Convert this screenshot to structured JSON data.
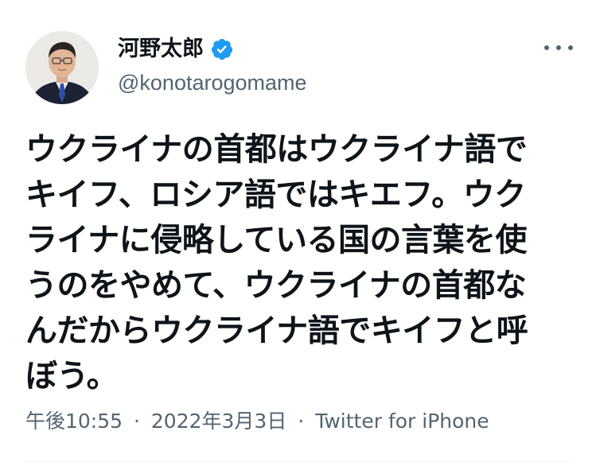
{
  "author": {
    "display_name": "河野太郎",
    "handle": "@konotarogomame",
    "verified_icon": "verified-badge-icon",
    "verified_color": "#1d9bf0"
  },
  "more_icon": "more-horizontal-icon",
  "tweet": {
    "lines": [
      "ウクライナの首都はウクライナ語で",
      "キイフ、ロシア語ではキエフ。ウク",
      "ライナに侵略している国の言葉を使",
      "うのをやめて、ウクライナの首都な",
      "んだからウクライナ語でキイフと呼",
      "ぼう。"
    ]
  },
  "meta": {
    "time": "午後10:55",
    "separator": "·",
    "date": "2022年3月3日",
    "source": "Twitter for iPhone"
  },
  "colors": {
    "text": "#0f1419",
    "secondary": "#536471",
    "divider": "#eff3f4"
  }
}
